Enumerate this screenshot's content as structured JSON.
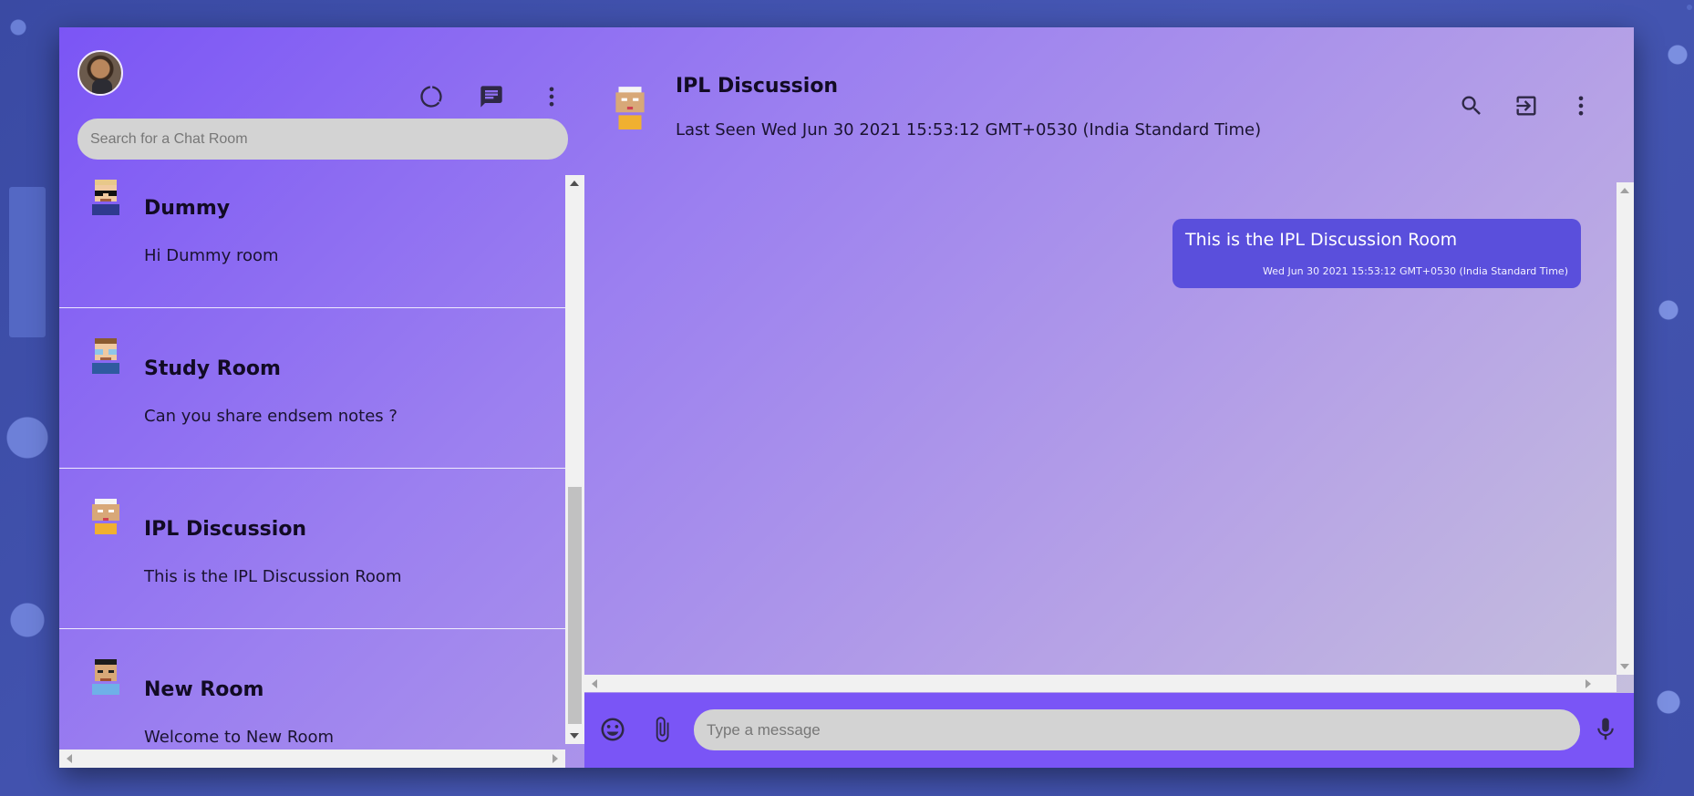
{
  "sidebar": {
    "search": {
      "placeholder": "Search for a Chat Room"
    },
    "rooms": [
      {
        "name": "Dummy",
        "last_message": "Hi Dummy room",
        "avatar": "pixel-avatar-glasses-dark"
      },
      {
        "name": "Study Room",
        "last_message": "Can you share endsem notes ?",
        "avatar": "pixel-avatar-glasses-brown"
      },
      {
        "name": "IPL Discussion",
        "last_message": "This is the IPL Discussion Room",
        "avatar": "pixel-avatar-elder-white-hair"
      },
      {
        "name": "New Room",
        "last_message": "Welcome to New Room",
        "avatar": "pixel-avatar-dark-hair"
      }
    ],
    "header_icons": [
      "status-ring-icon",
      "new-chat-icon",
      "more-vertical-icon"
    ]
  },
  "chat": {
    "title": "IPL Discussion",
    "last_seen": "Last Seen Wed Jun 30 2021 15:53:12 GMT+0530 (India Standard Time)",
    "header_icons": [
      "search-icon",
      "exit-icon",
      "more-vertical-icon"
    ],
    "messages": [
      {
        "text": "This is the IPL Discussion Room",
        "time": "Wed Jun 30 2021 15:53:12 GMT+0530 (India Standard Time)"
      }
    ],
    "composer": {
      "placeholder": "Type a message"
    }
  },
  "colors": {
    "primary": "#7b55f5",
    "message_bubble": "#5a4fdc",
    "input_bg": "#d3d3d3",
    "desktop_bg": "#3f4fa8"
  }
}
